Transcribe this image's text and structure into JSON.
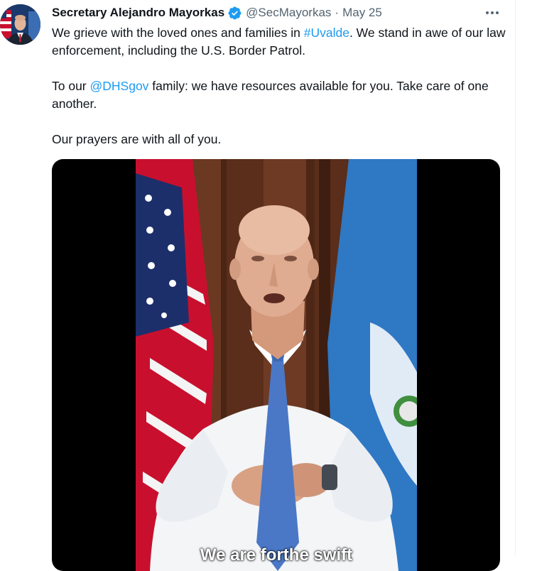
{
  "tweet": {
    "display_name": "Secretary Alejandro Mayorkas",
    "handle": "@SecMayorkas",
    "separator": "·",
    "date": "May 25",
    "verified_icon": "verified-badge-icon",
    "more_icon": "more-options-icon",
    "text": {
      "p1_part1": "We grieve with the loved ones and families in ",
      "p1_hashtag": "#Uvalde",
      "p1_part2": ". We stand in awe of our law enforcement, including the U.S. Border Patrol.",
      "p2_part1": "To our ",
      "p2_mention": "@DHSgov",
      "p2_part2": " family: we have resources available for you. Take care of one another.",
      "p3": "Our prayers are with all of you."
    },
    "video": {
      "subtitle_partial": "We are forthe swift"
    }
  },
  "colors": {
    "link": "#1d9bf0",
    "secondary_text": "#536471",
    "primary_text": "#0f1419",
    "verified": "#1d9bf0"
  }
}
